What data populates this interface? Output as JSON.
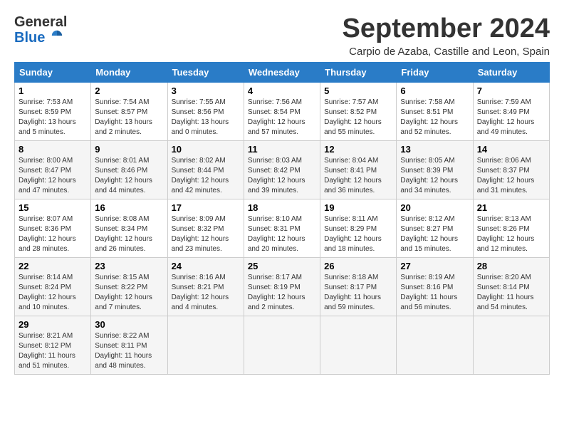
{
  "header": {
    "logo_general": "General",
    "logo_blue": "Blue",
    "month_title": "September 2024",
    "subtitle": "Carpio de Azaba, Castille and Leon, Spain"
  },
  "weekdays": [
    "Sunday",
    "Monday",
    "Tuesday",
    "Wednesday",
    "Thursday",
    "Friday",
    "Saturday"
  ],
  "weeks": [
    [
      {
        "day": "1",
        "info": "Sunrise: 7:53 AM\nSunset: 8:59 PM\nDaylight: 13 hours\nand 5 minutes."
      },
      {
        "day": "2",
        "info": "Sunrise: 7:54 AM\nSunset: 8:57 PM\nDaylight: 13 hours\nand 2 minutes."
      },
      {
        "day": "3",
        "info": "Sunrise: 7:55 AM\nSunset: 8:56 PM\nDaylight: 13 hours\nand 0 minutes."
      },
      {
        "day": "4",
        "info": "Sunrise: 7:56 AM\nSunset: 8:54 PM\nDaylight: 12 hours\nand 57 minutes."
      },
      {
        "day": "5",
        "info": "Sunrise: 7:57 AM\nSunset: 8:52 PM\nDaylight: 12 hours\nand 55 minutes."
      },
      {
        "day": "6",
        "info": "Sunrise: 7:58 AM\nSunset: 8:51 PM\nDaylight: 12 hours\nand 52 minutes."
      },
      {
        "day": "7",
        "info": "Sunrise: 7:59 AM\nSunset: 8:49 PM\nDaylight: 12 hours\nand 49 minutes."
      }
    ],
    [
      {
        "day": "8",
        "info": "Sunrise: 8:00 AM\nSunset: 8:47 PM\nDaylight: 12 hours\nand 47 minutes."
      },
      {
        "day": "9",
        "info": "Sunrise: 8:01 AM\nSunset: 8:46 PM\nDaylight: 12 hours\nand 44 minutes."
      },
      {
        "day": "10",
        "info": "Sunrise: 8:02 AM\nSunset: 8:44 PM\nDaylight: 12 hours\nand 42 minutes."
      },
      {
        "day": "11",
        "info": "Sunrise: 8:03 AM\nSunset: 8:42 PM\nDaylight: 12 hours\nand 39 minutes."
      },
      {
        "day": "12",
        "info": "Sunrise: 8:04 AM\nSunset: 8:41 PM\nDaylight: 12 hours\nand 36 minutes."
      },
      {
        "day": "13",
        "info": "Sunrise: 8:05 AM\nSunset: 8:39 PM\nDaylight: 12 hours\nand 34 minutes."
      },
      {
        "day": "14",
        "info": "Sunrise: 8:06 AM\nSunset: 8:37 PM\nDaylight: 12 hours\nand 31 minutes."
      }
    ],
    [
      {
        "day": "15",
        "info": "Sunrise: 8:07 AM\nSunset: 8:36 PM\nDaylight: 12 hours\nand 28 minutes."
      },
      {
        "day": "16",
        "info": "Sunrise: 8:08 AM\nSunset: 8:34 PM\nDaylight: 12 hours\nand 26 minutes."
      },
      {
        "day": "17",
        "info": "Sunrise: 8:09 AM\nSunset: 8:32 PM\nDaylight: 12 hours\nand 23 minutes."
      },
      {
        "day": "18",
        "info": "Sunrise: 8:10 AM\nSunset: 8:31 PM\nDaylight: 12 hours\nand 20 minutes."
      },
      {
        "day": "19",
        "info": "Sunrise: 8:11 AM\nSunset: 8:29 PM\nDaylight: 12 hours\nand 18 minutes."
      },
      {
        "day": "20",
        "info": "Sunrise: 8:12 AM\nSunset: 8:27 PM\nDaylight: 12 hours\nand 15 minutes."
      },
      {
        "day": "21",
        "info": "Sunrise: 8:13 AM\nSunset: 8:26 PM\nDaylight: 12 hours\nand 12 minutes."
      }
    ],
    [
      {
        "day": "22",
        "info": "Sunrise: 8:14 AM\nSunset: 8:24 PM\nDaylight: 12 hours\nand 10 minutes."
      },
      {
        "day": "23",
        "info": "Sunrise: 8:15 AM\nSunset: 8:22 PM\nDaylight: 12 hours\nand 7 minutes."
      },
      {
        "day": "24",
        "info": "Sunrise: 8:16 AM\nSunset: 8:21 PM\nDaylight: 12 hours\nand 4 minutes."
      },
      {
        "day": "25",
        "info": "Sunrise: 8:17 AM\nSunset: 8:19 PM\nDaylight: 12 hours\nand 2 minutes."
      },
      {
        "day": "26",
        "info": "Sunrise: 8:18 AM\nSunset: 8:17 PM\nDaylight: 11 hours\nand 59 minutes."
      },
      {
        "day": "27",
        "info": "Sunrise: 8:19 AM\nSunset: 8:16 PM\nDaylight: 11 hours\nand 56 minutes."
      },
      {
        "day": "28",
        "info": "Sunrise: 8:20 AM\nSunset: 8:14 PM\nDaylight: 11 hours\nand 54 minutes."
      }
    ],
    [
      {
        "day": "29",
        "info": "Sunrise: 8:21 AM\nSunset: 8:12 PM\nDaylight: 11 hours\nand 51 minutes."
      },
      {
        "day": "30",
        "info": "Sunrise: 8:22 AM\nSunset: 8:11 PM\nDaylight: 11 hours\nand 48 minutes."
      },
      null,
      null,
      null,
      null,
      null
    ]
  ]
}
